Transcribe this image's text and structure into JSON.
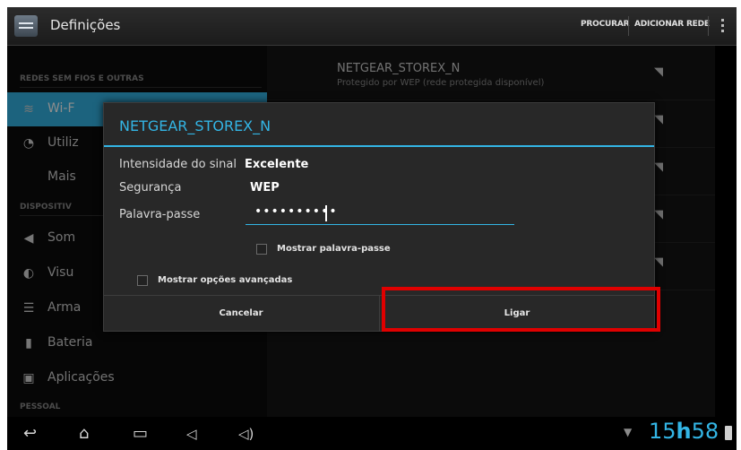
{
  "action_bar": {
    "title": "Definições",
    "search_label": "PROCURAR",
    "add_network_label": "ADICIONAR REDE"
  },
  "left_panel": {
    "section_wireless": "REDES SEM FIOS E OUTRAS",
    "item_wifi": "Wi-F",
    "item_data_usage": "Utiliz",
    "item_more": "Mais",
    "section_device": "DISPOSITIV",
    "item_sound": "Som",
    "item_display": "Visu",
    "item_storage": "Arma",
    "item_battery": "Bateria",
    "item_apps": "Aplicações",
    "section_personal": "PESSOAL"
  },
  "network_list": {
    "first_ssid": "NETGEAR_STOREX_N",
    "first_subtitle": "Protegido por WEP (rede protegida disponível)"
  },
  "dialog": {
    "title": "NETGEAR_STOREX_N",
    "signal_label": "Intensidade do sinal",
    "signal_value": "Excelente",
    "security_label": "Segurança",
    "security_value": "WEP",
    "password_label": "Palavra-passe",
    "password_value": "••••••••••",
    "show_password_label": "Mostrar palavra-passe",
    "show_advanced_label": "Mostrar opções avançadas",
    "cancel_label": "Cancelar",
    "connect_label": "Ligar"
  },
  "status_bar": {
    "time_hours": "15",
    "time_h": "h",
    "time_minutes": "58"
  },
  "colors": {
    "accent": "#33b5e5",
    "highlight": "#e00000"
  }
}
